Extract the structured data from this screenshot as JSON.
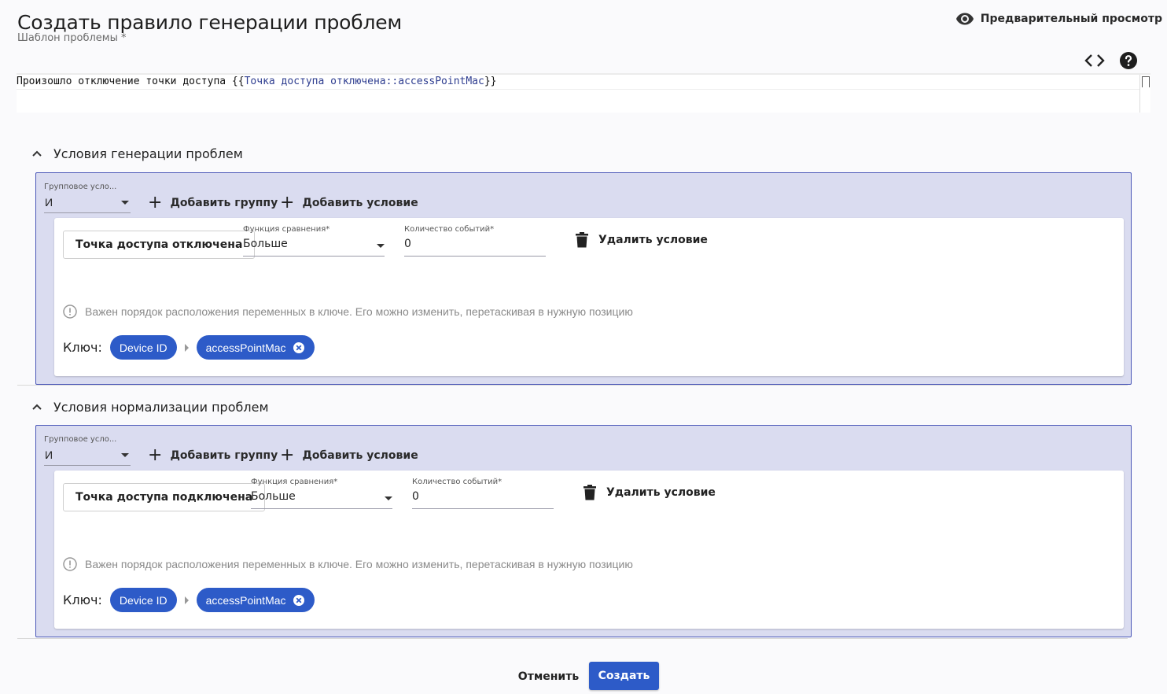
{
  "header": {
    "title": "Создать правило генерации проблем",
    "template_label": "Шаблон проблемы *",
    "preview_label": "Предварительный просмотр"
  },
  "editor": {
    "prefix": "Произошло отключение точки доступа {{",
    "variable": "Точка доступа отключена::accessPointMac",
    "suffix": "}}"
  },
  "sections": [
    {
      "title": "Условия генерации проблем",
      "group_label": "Групповое усло...",
      "group_value": "И",
      "add_group": "Добавить группу",
      "add_condition": "Добавить условие",
      "condition": {
        "event": "Точка доступа отключена",
        "func_label": "Функция сравнения*",
        "func_value": "Больше",
        "count_label": "Количество событий*",
        "count_value": "0",
        "delete": "Удалить условие",
        "hint": "Важен порядок расположения переменных в ключе. Его можно изменить, перетаскивая в нужную позицию",
        "key_label": "Ключ:",
        "chips": [
          "Device ID",
          "accessPointMac"
        ]
      }
    },
    {
      "title": "Условия нормализации проблем",
      "group_label": "Групповое усло...",
      "group_value": "И",
      "add_group": "Добавить группу",
      "add_condition": "Добавить условие",
      "condition": {
        "event": "Точка доступа подключена",
        "func_label": "Функция сравнения*",
        "func_value": "Больше",
        "count_label": "Количество событий*",
        "count_value": "0",
        "delete": "Удалить условие",
        "hint": "Важен порядок расположения переменных в ключе. Его можно изменить, перетаскивая в нужную позицию",
        "key_label": "Ключ:",
        "chips": [
          "Device ID",
          "accessPointMac"
        ]
      }
    }
  ],
  "footer": {
    "cancel": "Отменить",
    "create": "Создать"
  },
  "colors": {
    "accent": "#2d5bc8",
    "group_bg": "#dadcf0",
    "group_border": "#4a57b8",
    "variable": "#2d3c8f"
  }
}
